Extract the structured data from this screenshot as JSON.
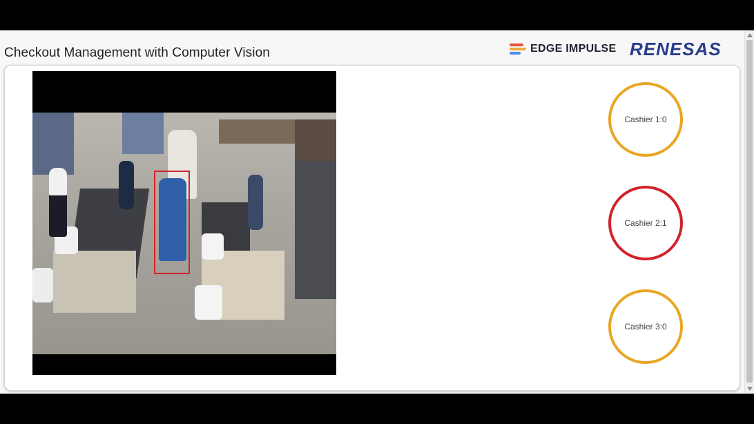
{
  "header": {
    "title": "Checkout Management with Computer Vision",
    "logos": {
      "edge_impulse": "EDGE IMPULSE",
      "renesas": "RENESAS"
    }
  },
  "video": {
    "icon": "camera-feed",
    "detection": "person-bounding-box"
  },
  "cashiers": [
    {
      "label": "Cashier 1:0",
      "status_color": "#e9a623"
    },
    {
      "label": "Cashier 2:1",
      "status_color": "#d1232a"
    },
    {
      "label": "Cashier 3:0",
      "status_color": "#e9a623"
    }
  ],
  "colors": {
    "accent_orange": "#e9a623",
    "alert_red": "#d1232a",
    "renesas_blue": "#283c8c",
    "edge_impulse_bars": [
      "#e94f3c",
      "#f3a83b",
      "#4c8ee6"
    ]
  }
}
